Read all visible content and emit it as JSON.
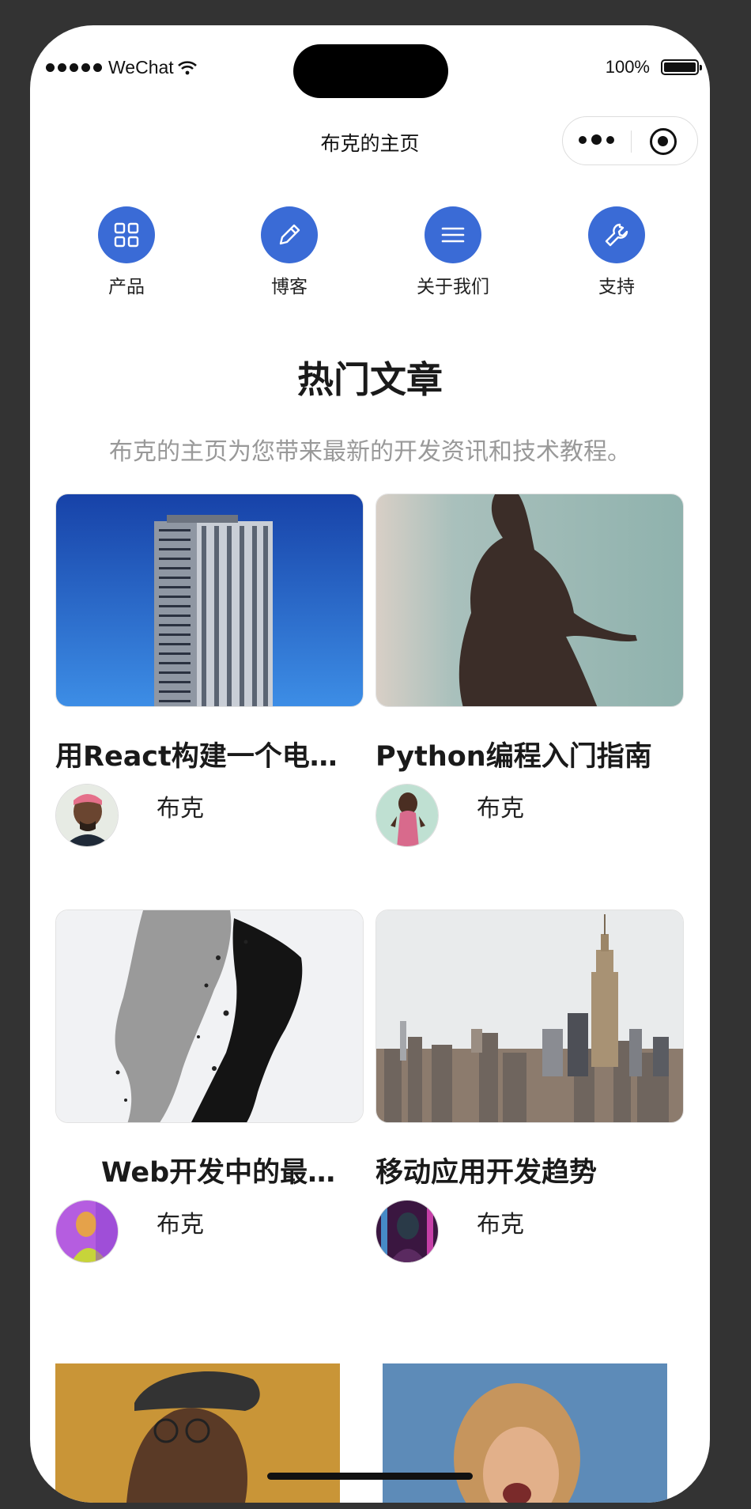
{
  "status": {
    "carrier": "WeChat",
    "battery": "100%"
  },
  "nav": {
    "title": "布克的主页"
  },
  "categories": [
    {
      "label": "产品",
      "icon": "grid-icon"
    },
    {
      "label": "博客",
      "icon": "pencil-icon"
    },
    {
      "label": "关于我们",
      "icon": "menu-icon"
    },
    {
      "label": "支持",
      "icon": "wrench-icon"
    }
  ],
  "section": {
    "title": "热门文章",
    "subtitle": "布克的主页为您带来最新的开发资讯和技术教程。"
  },
  "articles": [
    {
      "title": "用React构建一个电子商务网站",
      "author": "布克",
      "image": "building-photo"
    },
    {
      "title": "Python编程入门指南",
      "author": "布克",
      "image": "silhouette-photo"
    },
    {
      "title": "Web开发中的最佳实践",
      "author": "布克",
      "image": "sculpture-photo"
    },
    {
      "title": "移动应用开发趋势",
      "author": "布克",
      "image": "city-skyline-photo"
    }
  ],
  "colors": {
    "accent": "#3a6bd6"
  }
}
